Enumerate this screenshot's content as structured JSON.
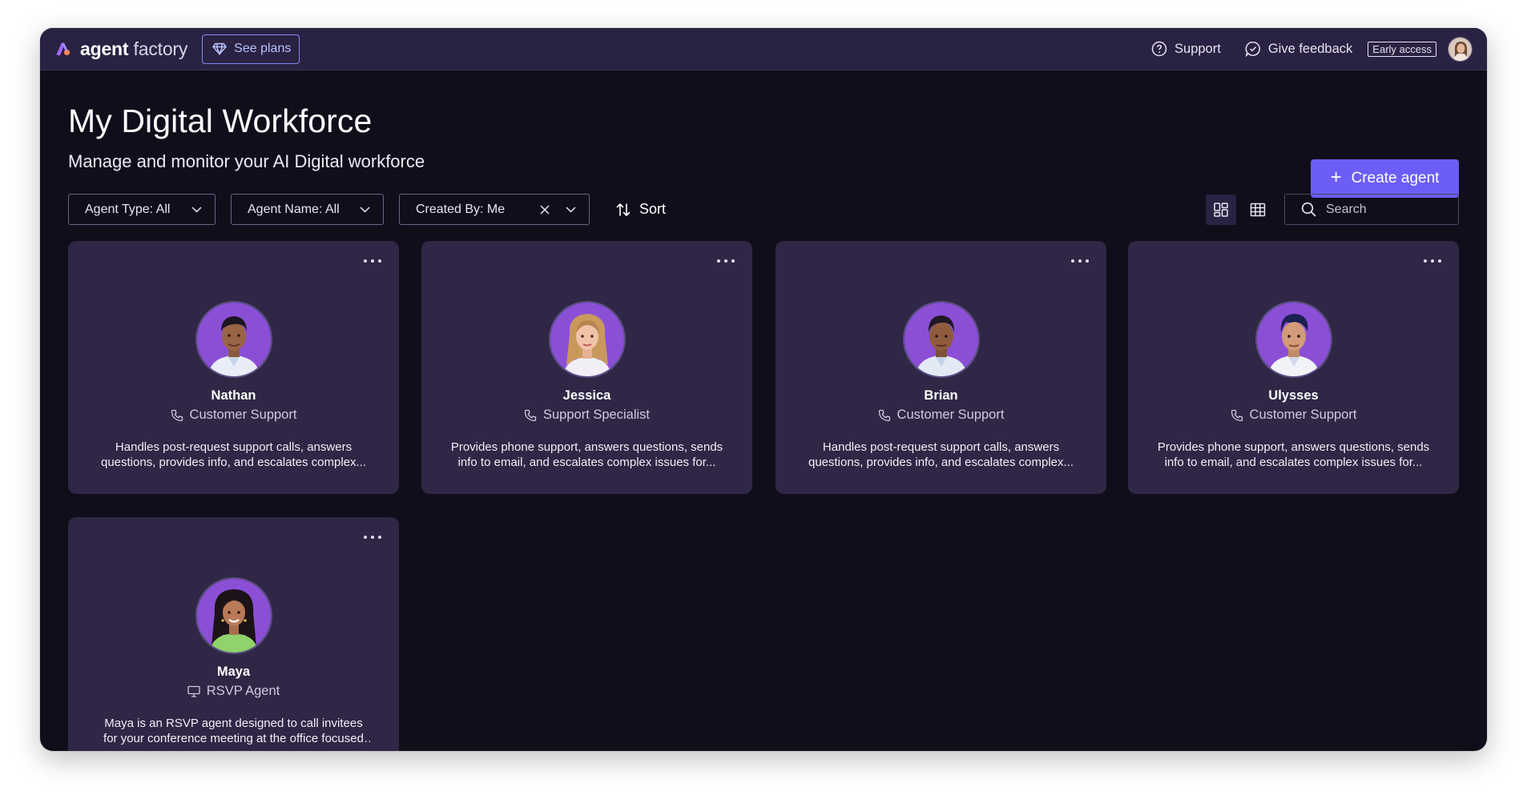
{
  "topbar": {
    "logo_bold": "agent",
    "logo_light": "factory",
    "see_plans": "See plans",
    "support": "Support",
    "feedback": "Give feedback",
    "early_access": "Early access",
    "icons": [
      "diamond-icon",
      "question-circle-icon",
      "feedback-bubble-icon",
      "user-avatar"
    ]
  },
  "header": {
    "title": "My Digital Workforce",
    "subtitle": "Manage and monitor your AI Digital workforce",
    "create_label": "Create agent"
  },
  "filters": {
    "agent_type": "Agent Type: All",
    "agent_name": "Agent Name: All",
    "created_by": "Created By: Me",
    "sort": "Sort",
    "search_placeholder": "Search"
  },
  "agents": [
    {
      "name": "Nathan",
      "role": "Customer Support",
      "role_icon": "phone-icon",
      "description": "Handles post-request support calls, answers questions, provides info, and escalates complex..."
    },
    {
      "name": "Jessica",
      "role": "Support Specialist",
      "role_icon": "phone-icon",
      "description": "Provides phone support, answers questions, sends info to email, and escalates complex issues for..."
    },
    {
      "name": "Brian",
      "role": "Customer Support",
      "role_icon": "phone-icon",
      "description": "Handles post-request support calls, answers questions, provides info, and escalates complex..."
    },
    {
      "name": "Ulysses",
      "role": "Customer Support",
      "role_icon": "phone-icon",
      "description": "Provides phone support, answers questions, sends info to email, and escalates complex issues for..."
    },
    {
      "name": "Maya",
      "role": "RSVP Agent",
      "role_icon": "monitor-icon",
      "description": "Maya is an RSVP agent designed to call invitees for your conference meeting at the office focused on..."
    }
  ],
  "colors": {
    "background": "#100e1b",
    "topbar": "#2a2242",
    "card": "#2f2745",
    "accent": "#6b5ef8",
    "avatar_bg": "#8b4fd6"
  }
}
